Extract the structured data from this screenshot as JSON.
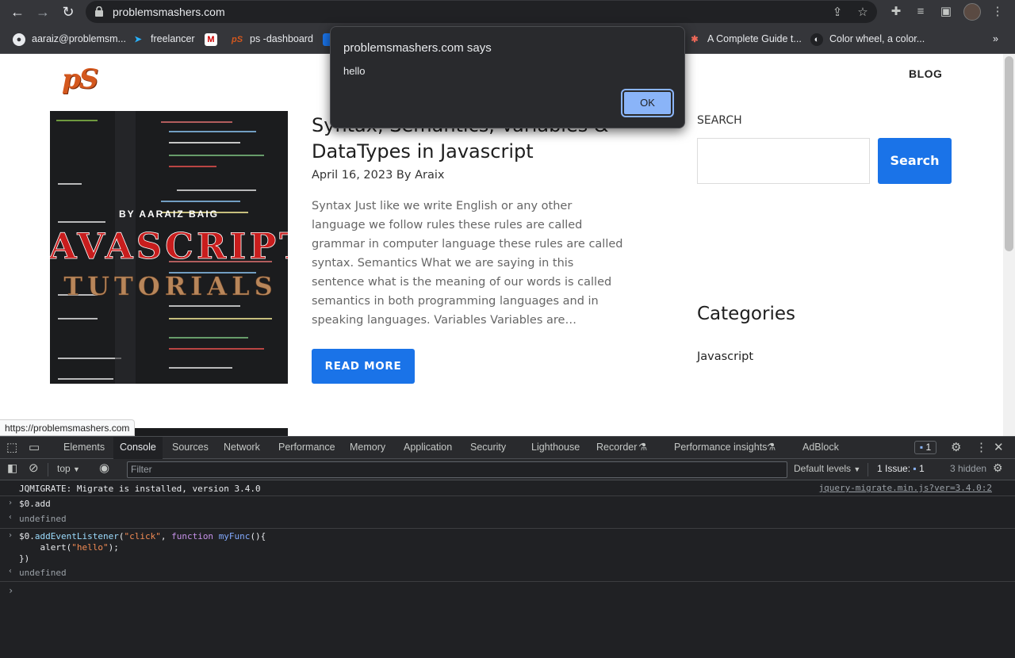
{
  "browser": {
    "url": "problemsmashers.com",
    "bookmarks": [
      {
        "label": "aaraiz@problemsm..."
      },
      {
        "label": "freelancer"
      },
      {
        "label": ""
      },
      {
        "label": "ps -dashboard"
      },
      {
        "label": "A Complete Guide t..."
      },
      {
        "label": "Color wheel, a color..."
      }
    ],
    "bookmarks_more": "»"
  },
  "dialog": {
    "title": "problemsmashers.com says",
    "message": "hello",
    "ok_label": "OK"
  },
  "site": {
    "logo": "pS",
    "nav": {
      "blog": "BLOG"
    },
    "post": {
      "title": "Syntax, Semantics, Variables & DataTypes in Javascript",
      "meta": "April 16, 2023 By Araix",
      "excerpt": "Syntax Just like we write English or any other language we follow rules these rules are called grammar in computer language these rules are called syntax. Semantics What we are saying in this sentence what is the meaning of our words is called semantics in both programming languages and in speaking languages. Variables Variables are…",
      "read_more": "READ MORE",
      "thumbnail": {
        "byline": "BY AARAIZ BAIG",
        "headline": "JAVASCRIPT",
        "subline": "TUTORIALS"
      }
    },
    "sidebar": {
      "search_label": "SEARCH",
      "search_button": "Search",
      "search_value": "",
      "categories_title": "Categories",
      "categories": [
        "Javascript"
      ]
    },
    "status_url": "https://problemsmashers.com"
  },
  "devtools": {
    "tabs": [
      "Elements",
      "Console",
      "Sources",
      "Network",
      "Performance",
      "Memory",
      "Application",
      "Security",
      "Lighthouse",
      "Recorder",
      "Performance insights",
      "AdBlock"
    ],
    "active_tab": "Console",
    "issues_badge": "1",
    "context": "top",
    "filter_placeholder": "Filter",
    "levels": "Default levels",
    "issues": "1 Issue:",
    "issues_count": "1",
    "hidden": "3 hidden",
    "console": {
      "migrate_msg": "JQMIGRATE: Migrate is installed, version 3.4.0",
      "migrate_src": "jquery-migrate.min.js?ver=3.4.0:2",
      "cmd1": "$0.add",
      "result1": "undefined",
      "cmd2_line1_obj": "$0.",
      "cmd2_line1_method": "addEventListener",
      "cmd2_line1_str": "\"click\"",
      "cmd2_line1_kw": "function",
      "cmd2_line1_fn": "myFunc",
      "cmd2_line2_pre": "    alert(",
      "cmd2_line2_str": "\"hello\"",
      "cmd2_line2_post": ");",
      "cmd2_line3": "})",
      "result2": "undefined"
    }
  }
}
